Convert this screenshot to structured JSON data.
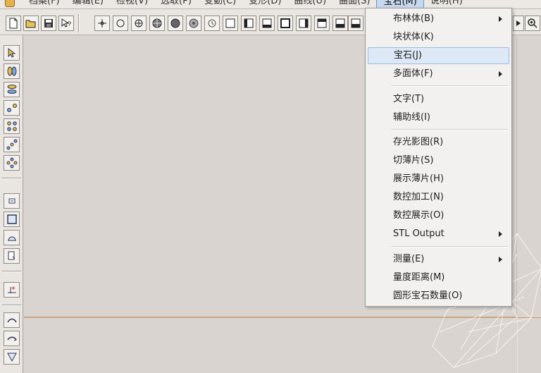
{
  "menubar": {
    "items": [
      {
        "label": "档案(F)"
      },
      {
        "label": "编辑(E)"
      },
      {
        "label": "检视(V)"
      },
      {
        "label": "选取(P)"
      },
      {
        "label": "变動(C)"
      },
      {
        "label": "变形(D)"
      },
      {
        "label": "曲线(U)"
      },
      {
        "label": "曲面(S)"
      },
      {
        "label": "宝石(M)"
      },
      {
        "label": "说明(H)"
      }
    ],
    "active_index": 8
  },
  "dropdown": {
    "items": [
      {
        "label": "布林体(B)",
        "submenu": true
      },
      {
        "label": "块状体(K)",
        "submenu": false
      },
      {
        "label": "宝石(J)",
        "submenu": false,
        "highlighted": true
      },
      {
        "label": "多面体(F)",
        "submenu": true
      },
      {
        "label": "文字(T)",
        "submenu": false
      },
      {
        "label": "辅助线(I)",
        "submenu": false
      },
      {
        "label": "存光影图(R)",
        "submenu": false
      },
      {
        "label": "切薄片(S)",
        "submenu": false
      },
      {
        "label": "展示薄片(H)",
        "submenu": false
      },
      {
        "label": "数控加工(N)",
        "submenu": false
      },
      {
        "label": "数控展示(O)",
        "submenu": false
      },
      {
        "label": "STL Output",
        "submenu": true
      },
      {
        "label": "测量(E)",
        "submenu": true
      },
      {
        "label": "量度距离(M)",
        "submenu": false
      },
      {
        "label": "圆形宝石数量(O)",
        "submenu": false
      }
    ]
  },
  "colors": {
    "viewport_bg": "#d9d4cf",
    "menu_highlight": "#dde9f6",
    "guide_line": "#c9a27e"
  }
}
